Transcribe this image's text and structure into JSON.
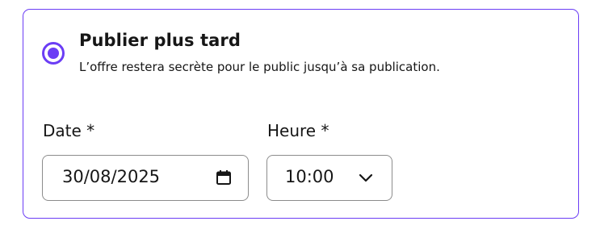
{
  "option": {
    "title": "Publier plus tard",
    "description": "L’offre restera secrète pour le public jusqu’à sa publication.",
    "selected": true
  },
  "date_field": {
    "label": "Date *",
    "value": "30/08/2025",
    "icon": "calendar-icon"
  },
  "time_field": {
    "label": "Heure *",
    "value": "10:00",
    "icon": "chevron-down-icon"
  },
  "colors": {
    "accent": "#6b3df5",
    "border": "#8c8c8c",
    "text": "#161616"
  }
}
